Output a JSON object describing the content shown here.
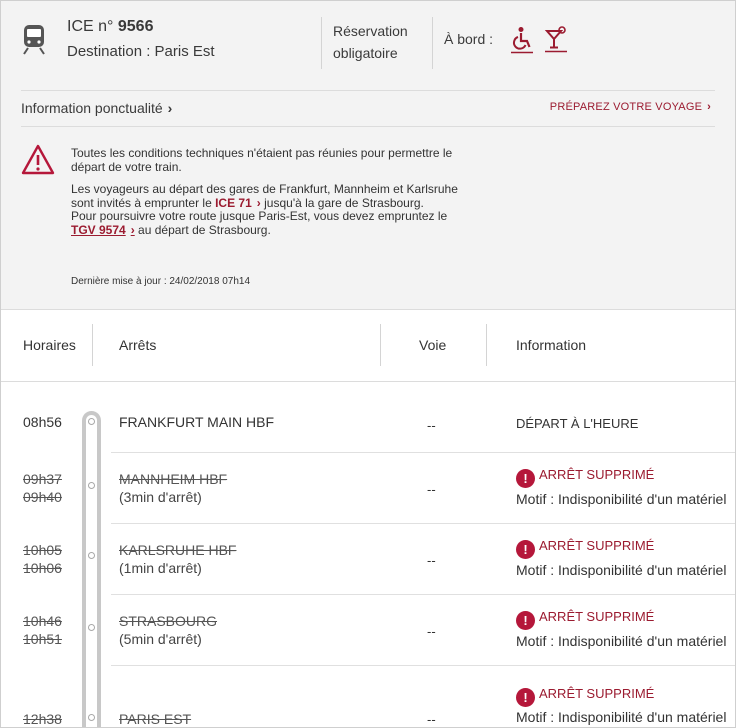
{
  "train": {
    "type_label": "ICE n°",
    "number": "9566",
    "destination": "Destination : Paris Est"
  },
  "reservation": {
    "line1": "Réservation",
    "line2": "obligatoire"
  },
  "aboard": {
    "label": "À bord :",
    "services": [
      "wheelchair-icon",
      "bar-icon"
    ]
  },
  "links": {
    "punctuality": "Information ponctualité",
    "prepare": "PRÉPAREZ VOTRE VOYAGE"
  },
  "alert": {
    "p1": "Toutes les conditions techniques n'étaient pas réunies pour permettre le départ de votre train.",
    "p2_a": "Les voyageurs au départ des gares de Frankfurt, Mannheim et Karlsruhe sont invités à emprunter le",
    "p2_link": "ICE 71",
    "p2_b": "jusqu'à la gare de Strasbourg.",
    "p3_a": "Pour poursuivre votre route jusque Paris-Est, vous devez empruntez le",
    "p3_link": "TGV 9574",
    "p3_b": "au départ de Strasbourg.",
    "last_update": "Dernière mise à jour : 24/02/2018 07h14"
  },
  "table": {
    "headers": {
      "horaires": "Horaires",
      "arrets": "Arrêts",
      "voie": "Voie",
      "information": "Information"
    },
    "rows": [
      {
        "time1": "08h56",
        "time2": "",
        "station": "FRANKFURT MAIN HBF",
        "sub": "",
        "voie": "--",
        "status": "DÉPART À L'HEURE",
        "motif": "",
        "suppressed": false
      },
      {
        "time1": "09h37",
        "time2": "09h40",
        "station": "MANNHEIM HBF",
        "sub": "(3min d'arrêt)",
        "voie": "--",
        "status": "ARRÊT SUPPRIMÉ",
        "motif": "Motif : Indisponibilité d'un matériel",
        "suppressed": true
      },
      {
        "time1": "10h05",
        "time2": "10h06",
        "station": "KARLSRUHE HBF",
        "sub": "(1min d'arrêt)",
        "voie": "--",
        "status": "ARRÊT SUPPRIMÉ",
        "motif": "Motif : Indisponibilité d'un matériel",
        "suppressed": true
      },
      {
        "time1": "10h46",
        "time2": "10h51",
        "station": "STRASBOURG",
        "sub": "(5min d'arrêt)",
        "voie": "--",
        "status": "ARRÊT SUPPRIMÉ",
        "motif": "Motif : Indisponibilité d'un matériel",
        "suppressed": true
      },
      {
        "time1": "12h38",
        "time2": "",
        "station": "PARIS EST",
        "sub": "",
        "voie": "--",
        "status": "ARRÊT SUPPRIMÉ",
        "motif": "Motif : Indisponibilité d'un matériel",
        "suppressed": true
      }
    ]
  },
  "colors": {
    "accent": "#9b1b30",
    "alert_icon": "#b5173a",
    "panel_bg": "#f3f3f3"
  }
}
